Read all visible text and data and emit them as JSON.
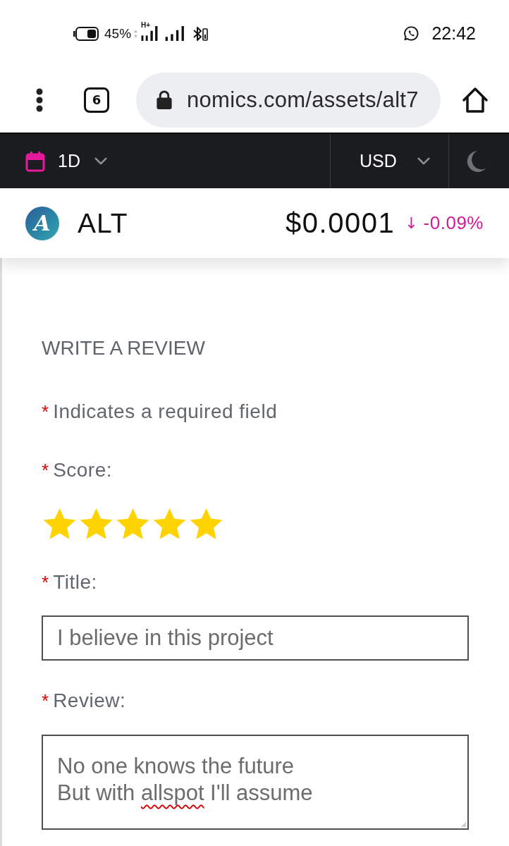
{
  "status_bar": {
    "battery": "45%",
    "network_type": "H+",
    "time": "22:42"
  },
  "browser": {
    "tab_count": "6",
    "url": "nomics.com/assets/alt7"
  },
  "toolbar": {
    "timeframe": "1D",
    "currency": "USD"
  },
  "asset": {
    "logo_letter": "A",
    "symbol": "ALT",
    "price": "$0.0001",
    "change_arrow": "↓",
    "change": "-0.09%"
  },
  "review_form": {
    "heading": "WRITE A REVIEW",
    "required_note": {
      "marker": "*",
      "text": "Indicates a required field"
    },
    "fields": [
      {
        "kind": "stars",
        "marker": "*",
        "label": "Score:",
        "stars": 5
      },
      {
        "kind": "text",
        "marker": "*",
        "label": "Title:",
        "value": "I believe in this project"
      },
      {
        "kind": "textarea",
        "marker": "*",
        "label": "Review:",
        "value": [
          {
            "text": "No one knows the future\nBut with ",
            "misspelled": false
          },
          {
            "text": "allspot",
            "misspelled": true
          },
          {
            "text": " I'll assume",
            "misspelled": false
          }
        ]
      }
    ]
  }
}
